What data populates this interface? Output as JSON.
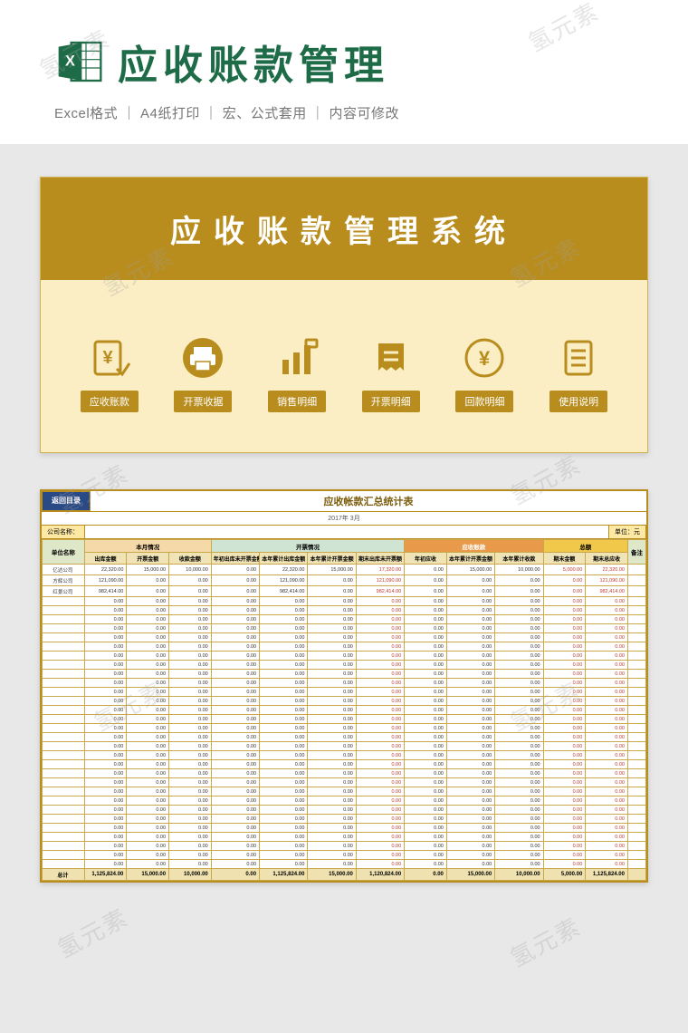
{
  "header": {
    "title": "应收账款管理",
    "sub_info": "Excel格式 ｜ A4纸打印 ｜ 宏、公式套用 ｜ 内容可修改"
  },
  "dashboard": {
    "banner": "应收账款管理系统",
    "nav": [
      {
        "label": "应收账款"
      },
      {
        "label": "开票收据"
      },
      {
        "label": "销售明细"
      },
      {
        "label": "开票明细"
      },
      {
        "label": "回款明细"
      },
      {
        "label": "使用说明"
      }
    ]
  },
  "sheet": {
    "back": "返回目录",
    "title": "应收帐款汇总统计表",
    "date": "2017年 3月",
    "company_label": "公司名称：",
    "groups": {
      "unit": "单位名称",
      "month": "本月情况",
      "invoice": "开票情况",
      "recv": "应收账款",
      "total": "总额",
      "notes": "备注"
    },
    "sub_heads": {
      "m1": "出库金额",
      "m2": "开票金额",
      "m3": "收款金额",
      "i1": "年初出库未开票金额",
      "i2": "本年累计出库金额",
      "i3": "本年累计开票金额",
      "i4": "期末出库未开票额",
      "r1": "年初应收",
      "r2": "本年累计开票金额",
      "r3": "本年累计收款",
      "t1": "期末金额",
      "t2": "期末总应收"
    },
    "unit_label": "单位：元",
    "totals_label": "总计",
    "chart_data": {
      "type": "table",
      "columns": [
        "单位名称",
        "出库金额",
        "开票金额",
        "收款金额",
        "年初出库未开票金额",
        "本年累计出库金额",
        "本年累计开票金额",
        "期末出库未开票额",
        "年初应收",
        "本年累计开票金额",
        "本年累计收款",
        "期末金额",
        "期末总应收"
      ],
      "rows": [
        {
          "name": "亿达公司",
          "vals": [
            "22,320.00",
            "15,000.00",
            "10,000.00",
            "0.00",
            "22,320.00",
            "15,000.00",
            "17,320.00",
            "0.00",
            "15,000.00",
            "10,000.00",
            "5,000.00",
            "22,320.00"
          ]
        },
        {
          "name": "方辉公司",
          "vals": [
            "121,090.00",
            "0.00",
            "0.00",
            "0.00",
            "121,090.00",
            "0.00",
            "121,090.00",
            "0.00",
            "0.00",
            "0.00",
            "0.00",
            "121,090.00"
          ]
        },
        {
          "name": "红景公司",
          "vals": [
            "982,414.00",
            "0.00",
            "0.00",
            "0.00",
            "982,414.00",
            "0.00",
            "982,414.00",
            "0.00",
            "0.00",
            "0.00",
            "0.00",
            "982,414.00"
          ]
        }
      ],
      "zero_row": {
        "name": "",
        "vals": [
          "0.00",
          "0.00",
          "0.00",
          "0.00",
          "0.00",
          "0.00",
          "0.00",
          "0.00",
          "0.00",
          "0.00",
          "0.00",
          "0.00"
        ]
      },
      "zero_row_count": 30,
      "totals": [
        "1,125,824.00",
        "15,000.00",
        "10,000.00",
        "0.00",
        "1,125,824.00",
        "15,000.00",
        "1,120,824.00",
        "0.00",
        "15,000.00",
        "10,000.00",
        "5,000.00",
        "1,125,824.00"
      ]
    }
  },
  "watermark": "氢元素"
}
